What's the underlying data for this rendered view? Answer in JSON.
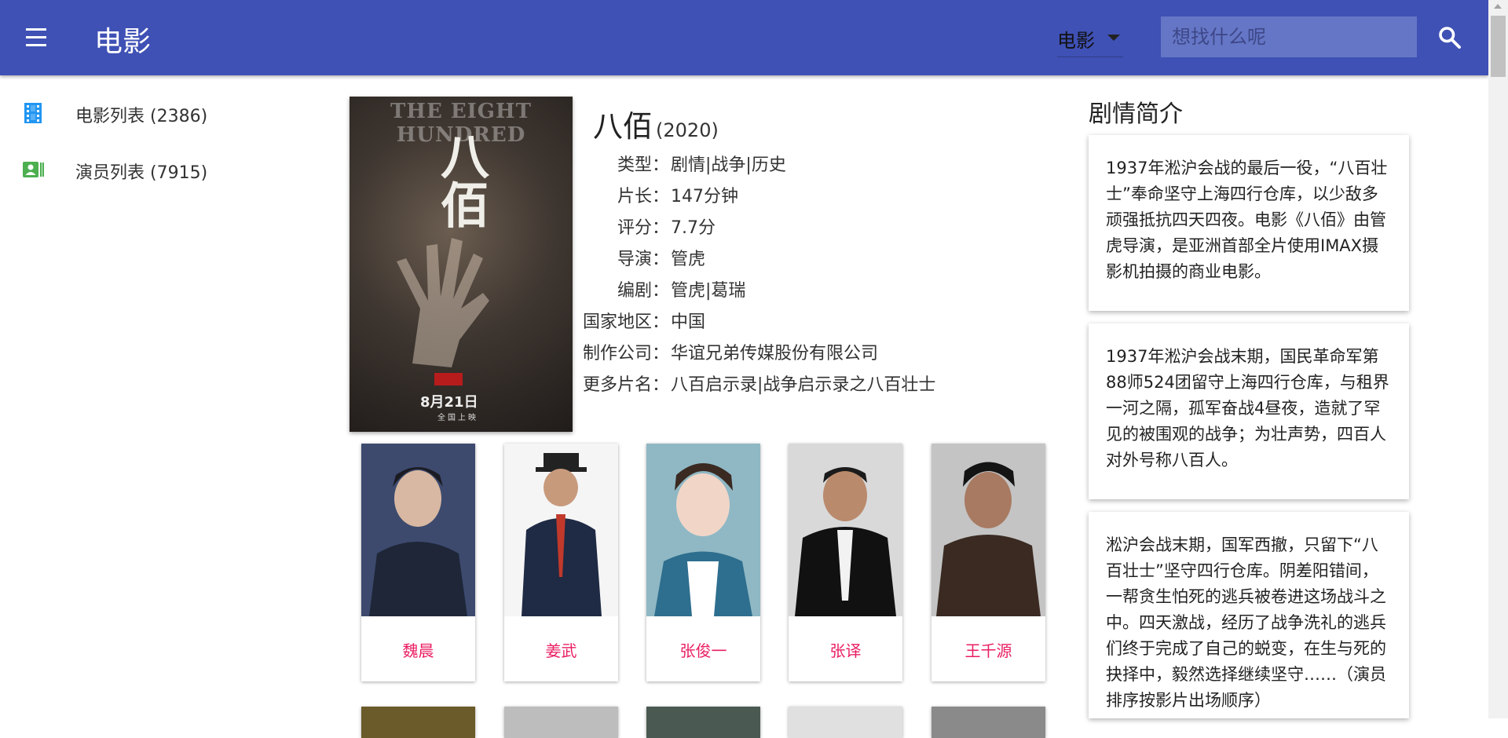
{
  "header": {
    "title": "电影",
    "category": "电影",
    "search_placeholder": "想找什么呢",
    "bg_color": "#3f51b5"
  },
  "sidebar": {
    "items": [
      {
        "label": "电影列表 (2386)",
        "icon": "film-icon",
        "icon_color": "#2196f3"
      },
      {
        "label": "演员列表 (7915)",
        "icon": "contacts-icon",
        "icon_color": "#4caf50"
      }
    ]
  },
  "movie": {
    "title": "八佰",
    "year": "(2020)",
    "poster": {
      "english_title": "THE EIGHT HUNDRED",
      "chinese_title": "八佰",
      "date": "8月21日",
      "subtitle": "全国上映"
    },
    "info": [
      {
        "key": "类型：",
        "value": "剧情|战争|历史"
      },
      {
        "key": "片长：",
        "value": "147分钟"
      },
      {
        "key": "评分：",
        "value": "7.7分"
      },
      {
        "key": "导演：",
        "value": "管虎"
      },
      {
        "key": "编剧：",
        "value": "管虎|葛瑞"
      },
      {
        "key": "国家地区：",
        "value": "中国"
      },
      {
        "key": "制作公司：",
        "value": "华谊兄弟传媒股份有限公司"
      },
      {
        "key": "更多片名：",
        "value": "八百启示录|战争启示录之八百壮士"
      }
    ]
  },
  "synopsis": {
    "title": "剧情简介",
    "cards": [
      "1937年淞沪会战的最后一役，“八百壮士”奉命坚守上海四行仓库，以少敌多顽强抵抗四天四夜。电影《八佰》由管虎导演，是亚洲首部全片使用IMAX摄影机拍摄的商业电影。",
      "1937年淞沪会战末期，国民革命军第88师524团留守上海四行仓库，与租界一河之隔，孤军奋战4昼夜，造就了罕见的被围观的战争；为壮声势，四百人对外号称八百人。",
      "淞沪会战末期，国军西撤，只留下“八百壮士”坚守四行仓库。阴差阳错间，一帮贪生怕死的逃兵被卷进这场战斗之中。四天激战，经历了战争洗礼的逃兵们终于完成了自己的蜕变，在生与死的抉择中，毅然选择继续坚守……（演员排序按影片出场顺序）"
    ]
  },
  "actors": [
    {
      "name": "魏晨"
    },
    {
      "name": "姜武"
    },
    {
      "name": "张俊一"
    },
    {
      "name": "张译"
    },
    {
      "name": "王千源"
    }
  ]
}
